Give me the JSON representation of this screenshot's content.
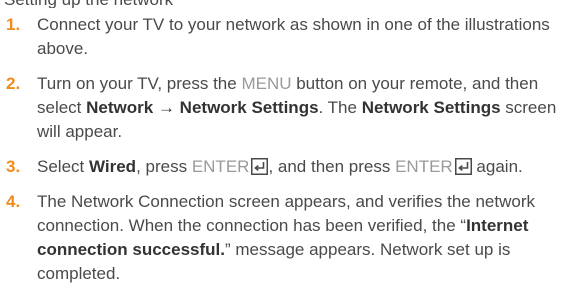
{
  "top_fragment": "Setting up the network",
  "steps": [
    {
      "number": "1.",
      "text": "Connect your TV to your network as shown in one of the illustrations above."
    },
    {
      "number": "2.",
      "t1": "Turn on your TV, press the ",
      "menu_key": "MENU",
      "t2": " button on your remote, and then select ",
      "network": "Network",
      "arrow": " → ",
      "network_settings": "Network Settings",
      "t3": ". The ",
      "network_settings_2": "Network Settings",
      "t4": " screen will appear."
    },
    {
      "number": "3.",
      "t1": "Select ",
      "wired": "Wired",
      "t2": ", press ",
      "enter_key_1": "ENTER",
      "t3": ", and then press ",
      "enter_key_2": "ENTER",
      "t4": " again."
    },
    {
      "number": "4.",
      "t1": "The Network Connection screen appears, and verifies the network connection. When the connection has been verified, the “",
      "success_msg": "Internet connection successful.",
      "t2": "” message appears. Network set up is completed."
    }
  ],
  "colors": {
    "accent": "#f08c1e",
    "body_text": "#4a4a4a",
    "key_text": "#9a9a9a"
  },
  "icons": {
    "enter": "enter-key-icon"
  }
}
